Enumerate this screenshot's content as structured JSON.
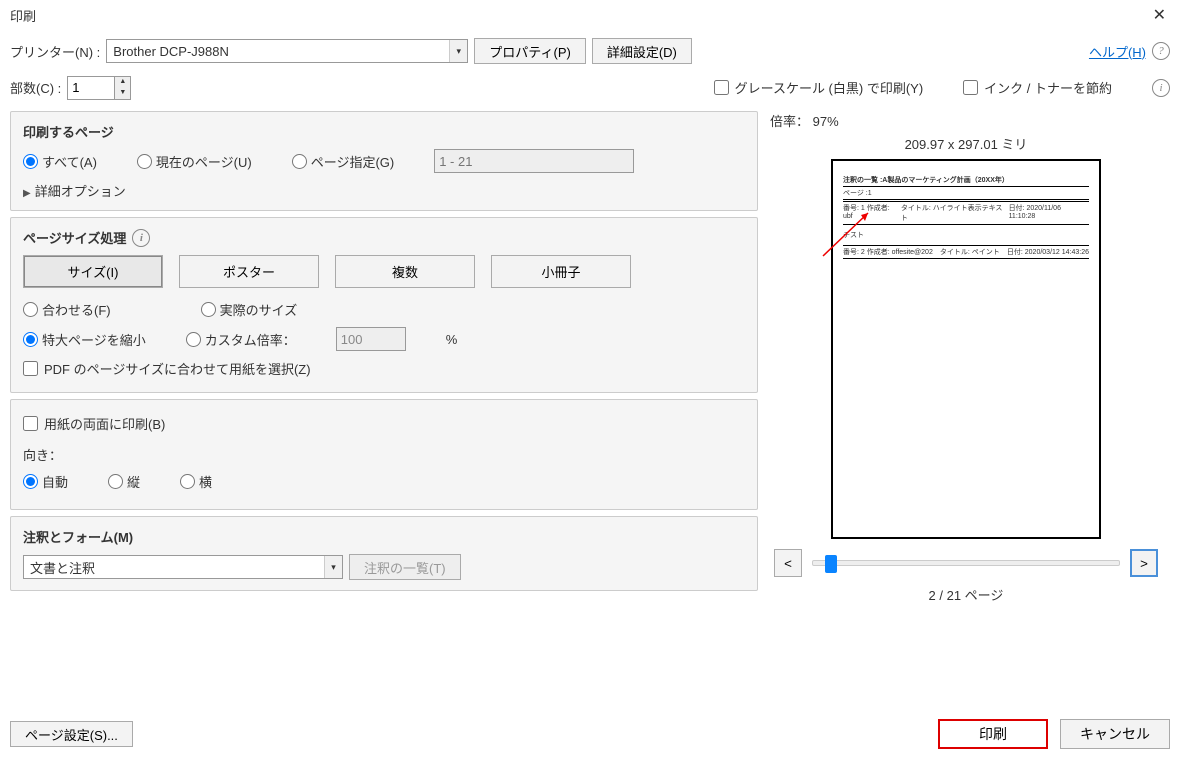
{
  "titlebar": {
    "title": "印刷"
  },
  "top": {
    "printer_label": "プリンター(N) :",
    "printer_value": "Brother DCP-J988N",
    "properties_btn": "プロパティ(P)",
    "advanced_btn": "詳細設定(D)",
    "help_link": "ヘルプ(H)",
    "copies_label": "部数(C) :",
    "copies_value": "1",
    "grayscale_label": "グレースケール (白黒) で印刷(Y)",
    "savetoner_label": "インク / トナーを節約"
  },
  "pages": {
    "section_title": "印刷するページ",
    "all": "すべて(A)",
    "current": "現在のページ(U)",
    "range_label": "ページ指定(G)",
    "range_placeholder": "1 - 21",
    "more": "詳細オプション"
  },
  "sizing": {
    "section_title": "ページサイズ処理",
    "tab_size": "サイズ(I)",
    "tab_poster": "ポスター",
    "tab_multi": "複数",
    "tab_booklet": "小冊子",
    "fit": "合わせる(F)",
    "actual": "実際のサイズ",
    "shrink": "特大ページを縮小",
    "custom": "カスタム倍率：",
    "custom_value": "100",
    "percent": "%",
    "choose_paper": "PDF のページサイズに合わせて用紙を選択(Z)"
  },
  "duplex": {
    "duplex_label": "用紙の両面に印刷(B)",
    "orientation_label": "向き：",
    "auto": "自動",
    "portrait": "縦",
    "landscape": "横"
  },
  "comments": {
    "section_title": "注釈とフォーム(M)",
    "dropdown_value": "文書と注釈",
    "summarize_btn": "注釈の一覧(T)"
  },
  "preview": {
    "scale_label": "倍率：",
    "scale_value": "97%",
    "dimensions": "209.97 x 297.01 ミリ",
    "doc_title": "注釈の一覧 :A製品のマーケティング計画（20XX年）",
    "page_line": "ページ :1",
    "meta1_left": "番号: 1   作成者: ubf",
    "meta1_mid": "タイトル: ハイライト表示テキスト",
    "meta1_right": "日付: 2020/11/06 11:10:28",
    "body_text": "テスト",
    "meta2_left": "番号: 2   作成者: offesite@202",
    "meta2_mid": "タイトル: ペイント",
    "meta2_right": "日付: 2020/03/12 14:43:26",
    "prev_btn": "<",
    "next_btn": ">",
    "counter": "2 / 21 ページ"
  },
  "footer": {
    "page_setup": "ページ設定(S)...",
    "print": "印刷",
    "cancel": "キャンセル"
  }
}
